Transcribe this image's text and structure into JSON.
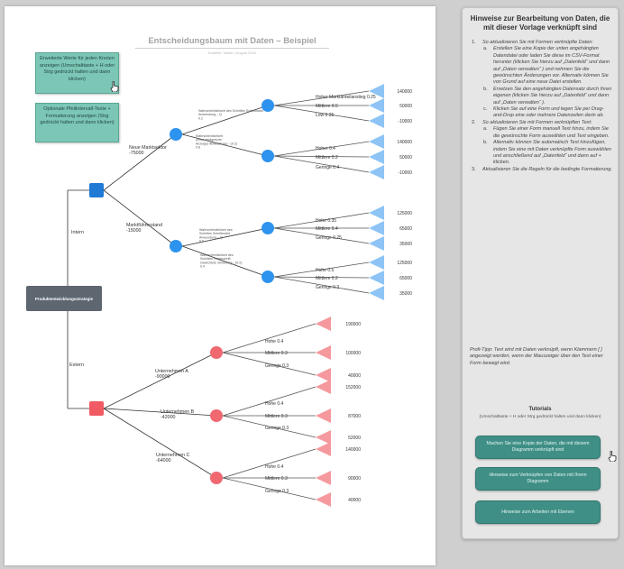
{
  "document": {
    "title": "Entscheidungsbaum mit Daten – Beispiel",
    "subtitle": "Ersteller: Name  |  August 2024"
  },
  "notes": {
    "note1": "Erweiterte Werte für jeden Knoten anzeigen (Umschalttaste + H oder Strg gedrückt halten und dann klicken)",
    "note2": "Optionale Pfeilintervall-Texte + Formatierung anzeigen (Strg gedrückt halten und dann klicken)"
  },
  "tree": {
    "root": "Produktentwicklungsstrategie",
    "branch_intern": "Intern",
    "branch_extern": "Extern",
    "intern_a": "Neue Marktsektor\n-75000",
    "intern_a_edge1": "Wahrscheinlichkeit des Schrittes Schrittmarkt\nAnwendung – Q\n0.2",
    "intern_a_edge2": "Wahrscheinlichkeit\n(neue erfolgreiche\nAnzeige) Abweichung ~ (0.2)\n0.8",
    "intern_b": "Marktführerstand\n-15000",
    "intern_b_edge1": "Wahrscheinlichkeit des\nSchrittes Schrittmarkt\nAnwendung – Q\n0.6",
    "intern_b_edge2": "Wahrscheinlichkeit des\nSchrittes Folgeschritt\nGewichtete Verteilung ~ (0.2)\n0.4",
    "leaves_intern": [
      {
        "label": "Hoher Marktanteilanstieg 0.25",
        "value": "140000"
      },
      {
        "label": "Mittlere 0.5",
        "value": "50000"
      },
      {
        "label": "Low 0.25",
        "value": "-10000"
      },
      {
        "label": "Hoher 0.4",
        "value": "140000"
      },
      {
        "label": "Mittlere 0.2",
        "value": "50000"
      },
      {
        "label": "Geringe 0.4",
        "value": "-10000"
      },
      {
        "label": "Hohe 0.35",
        "value": "125000"
      },
      {
        "label": "Mittlere 0.4",
        "value": "65000"
      },
      {
        "label": "Geringe 0.25",
        "value": "35000"
      },
      {
        "label": "Hohe 0.5",
        "value": "125000"
      },
      {
        "label": "Mittlere 0.2",
        "value": "65000"
      },
      {
        "label": "Geringe 0.3",
        "value": "35000"
      }
    ],
    "extern_a": "Unternehmen A\n-90000",
    "extern_b": "Unternehmen B\n-42000",
    "extern_c": "Unternehmen C\n-64000",
    "leaves_extern": [
      {
        "label": "Hohe 0.4",
        "value": "190000"
      },
      {
        "label": "Mittlere 0.3",
        "value": "100000"
      },
      {
        "label": "Geringe 0.3",
        "value": "40000"
      },
      {
        "label": "Hohe 0.4",
        "value": "152000"
      },
      {
        "label": "Mittlere 0.3",
        "value": "87000"
      },
      {
        "label": "Geringe 0.3",
        "value": "52000"
      },
      {
        "label": "Hohe 0.4",
        "value": "140000"
      },
      {
        "label": "Mittlere 0.3",
        "value": "90000"
      },
      {
        "label": "Geringe 0.3",
        "value": "40000"
      }
    ]
  },
  "sidebar": {
    "title": "Hinweise zur Bearbeitung von Daten, die mit dieser Vorlage verknüpft sind",
    "steps": [
      {
        "num": "1.",
        "level": 1,
        "text": "So aktualisieren Sie mit Formen verknüpfte Daten:"
      },
      {
        "num": "a.",
        "level": 2,
        "text": "Erstellen Sie eine Kopie der unten angehängten Datendatei oder laden Sie diese im CSV-Format herunter (klicken Sie hierzu auf „Datenfeld“ und dann auf „Daten verwalten“ ) und nehmen Sie die gewünschten Änderungen vor. Alternativ können Sie von Grund auf eine neue Datei erstellen."
      },
      {
        "num": "b.",
        "level": 2,
        "text": "Ersetzen Sie den angehängten Datensatz durch Ihren eigenen (klicken Sie hierzu auf „Datenfeld“ und dann auf „Daten verwalten“ )."
      },
      {
        "num": "c.",
        "level": 2,
        "text": "Klicken Sie auf eine Form und legen Sie per Drag-and-Drop eine oder mehrere Datenzeilen darin ab."
      },
      {
        "num": "2.",
        "level": 1,
        "text": "So aktualisieren Sie mit Formen verknüpften Text:"
      },
      {
        "num": "a.",
        "level": 2,
        "text": "Fügen Sie einer Form manuell Text hinzu, indem Sie die gewünschte Form auswählen und Text eingeben."
      },
      {
        "num": "b.",
        "level": 2,
        "text": "Alternativ können Sie automatisch Text hinzufügen, indem Sie eine mit Daten verknüpfte Form auswählen und anschließend auf „Datenfeld“ und dann auf + klicken."
      },
      {
        "num": "3.",
        "level": 1,
        "text": "Aktualisieren Sie die Regeln für die bedingte Formatierung."
      }
    ],
    "tip_label": "Profi-Tipp:",
    "tip": "Text wird mit Daten verknüpft, wenn Klammern [ ] angezeigt werden, wenn der Mauszeiger über den Text einer Form bewegt wird.",
    "tutorials_heading": "Tutorials",
    "tutorials_desc": "(Umschalttaste + H oder Strg gedrückt halten und dann klicken)",
    "buttons": [
      "Machen Sie eine Kopie der Daten, die mit diesem Diagramm verknüpft sind",
      "Hinweise zum Verknüpfen von Daten mit Ihrem Diagramm",
      "Hinweise zum Arbeiten mit Ebenen"
    ]
  },
  "colors": {
    "intern_node": "#1f7ad6",
    "intern_chance": "#2e93ee",
    "intern_leaf": "#8ec4f5",
    "extern_node": "#f05a62",
    "extern_chance": "#f06870",
    "extern_leaf": "#f5999e",
    "button": "#3f8f86",
    "note": "#7cc6b6"
  }
}
